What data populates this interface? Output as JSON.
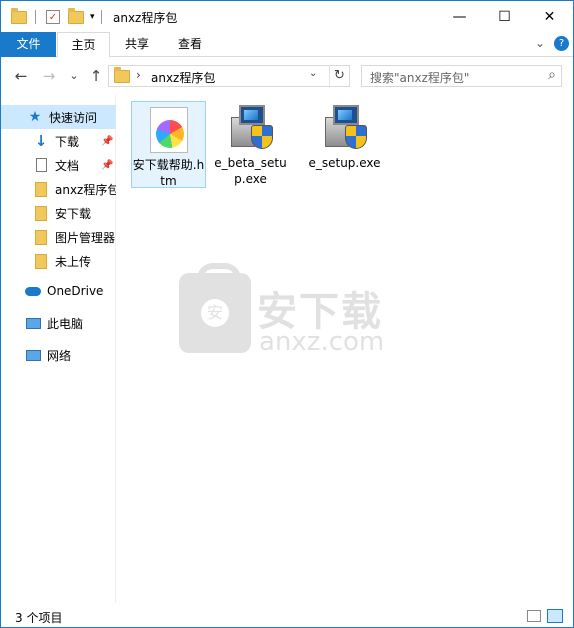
{
  "window": {
    "title": "anxz程序包",
    "minimize_glyph": "—",
    "maximize_glyph": "☐",
    "close_glyph": "✕"
  },
  "ribbon": {
    "tabs": [
      "文件",
      "主页",
      "共享",
      "查看"
    ],
    "expand_glyph": "⌄",
    "help_glyph": "?"
  },
  "nav_buttons": {
    "back": "←",
    "forward": "→",
    "recent": "⌄",
    "up": "↑"
  },
  "address": {
    "chevron": "›",
    "path": "anxz程序包",
    "dropdown_glyph": "⌄",
    "refresh_glyph": "↻"
  },
  "search": {
    "placeholder": "搜索\"anxz程序包\"",
    "icon_glyph": "⌕"
  },
  "sidebar": {
    "items": [
      {
        "label": "快速访问",
        "icon": "star-icon"
      },
      {
        "label": "下载",
        "icon": "download-icon",
        "pinned": true
      },
      {
        "label": "文档",
        "icon": "document-icon",
        "pinned": true
      },
      {
        "label": "anxz程序包",
        "icon": "folder-icon"
      },
      {
        "label": "安下载",
        "icon": "folder-icon"
      },
      {
        "label": "图片管理器",
        "icon": "folder-icon"
      },
      {
        "label": "未上传",
        "icon": "folder-icon"
      },
      {
        "label": "OneDrive",
        "icon": "cloud-icon"
      },
      {
        "label": "此电脑",
        "icon": "computer-icon"
      },
      {
        "label": "网络",
        "icon": "network-icon"
      }
    ],
    "pin_glyph": "📌"
  },
  "files": [
    {
      "name": "安下载帮助.htm",
      "icon": "htm-file-icon",
      "selected": true
    },
    {
      "name": "e_beta_setup.exe",
      "icon": "installer-icon"
    },
    {
      "name": "e_setup.exe",
      "icon": "installer-icon"
    }
  ],
  "watermark": {
    "text": "安下载",
    "domain": "anxz.com"
  },
  "status": {
    "count": "3 个项目"
  },
  "colors": {
    "accent": "#1979ca",
    "selection": "#cce8ff"
  }
}
